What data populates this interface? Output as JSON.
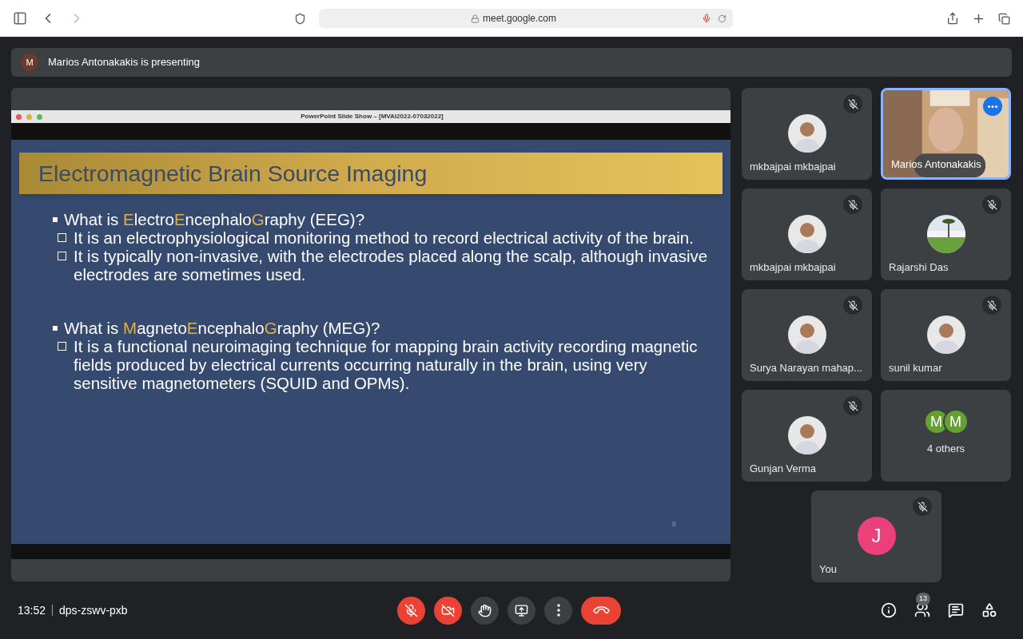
{
  "browser": {
    "url": "meet.google.com"
  },
  "presenting": {
    "initial": "M",
    "text": "Marios Antonakakis is presenting"
  },
  "slide_window": {
    "title": "PowerPoint Slide Show – [MVAI2022-07032022]",
    "slide_title": "Electromagnetic Brain Source Imaging",
    "page_number": "8",
    "bullets": [
      {
        "segments": [
          {
            "text": "What is ",
            "accent": false
          },
          {
            "text": "E",
            "accent": true
          },
          {
            "text": "lectro",
            "accent": false
          },
          {
            "text": "E",
            "accent": true
          },
          {
            "text": "ncephalo",
            "accent": false
          },
          {
            "text": "G",
            "accent": true
          },
          {
            "text": "raphy (EEG)?",
            "accent": false
          }
        ],
        "subitems": [
          "It is an electrophysiological monitoring method to record electrical activity of the brain.",
          "It is typically non-invasive, with the electrodes placed along the scalp, although invasive electrodes are sometimes used."
        ]
      },
      {
        "segments": [
          {
            "text": "What is ",
            "accent": false
          },
          {
            "text": "M",
            "accent": true
          },
          {
            "text": "agneto",
            "accent": false
          },
          {
            "text": "E",
            "accent": true
          },
          {
            "text": "ncephalo",
            "accent": false
          },
          {
            "text": "G",
            "accent": true
          },
          {
            "text": "raphy (MEG)?",
            "accent": false
          }
        ],
        "subitems": [
          "It is a functional neuroimaging technique for mapping brain activity recording magnetic fields produced by electrical currents occurring naturally in the brain, using very sensitive magnetometers (SQUID and OPMs)."
        ]
      }
    ]
  },
  "tiles": [
    {
      "name": "mkbajpai mkbajpai",
      "muted": true,
      "highlighted": false
    },
    {
      "kind": "video",
      "name": "Marios Antonakakis",
      "muted": false,
      "highlighted": true
    },
    {
      "name": "mkbajpai mkbajpai",
      "muted": true,
      "highlighted": false
    },
    {
      "kind": "landscape",
      "name": "Rajarshi Das",
      "muted": true,
      "highlighted": false
    },
    {
      "name": "Surya Narayan mahap...",
      "muted": true,
      "highlighted": false
    },
    {
      "name": "sunil kumar",
      "muted": true,
      "highlighted": false
    },
    {
      "name": "Gunjan Verma",
      "muted": true,
      "highlighted": false
    },
    {
      "kind": "others",
      "name": "4 others",
      "initials": [
        "M",
        "M"
      ],
      "muted": false,
      "highlighted": false
    },
    {
      "kind": "initial",
      "name": "You",
      "initial": "J",
      "muted": true,
      "highlighted": false
    }
  ],
  "footer": {
    "time": "13:52",
    "meeting_code": "dps-zswv-pxb",
    "participants_count": "13"
  },
  "controls": [
    {
      "kind": "mic",
      "off": true
    },
    {
      "kind": "camera",
      "off": true
    },
    {
      "kind": "hand",
      "off": false
    },
    {
      "kind": "present",
      "off": false
    },
    {
      "kind": "more",
      "off": false
    },
    {
      "kind": "leave"
    }
  ]
}
